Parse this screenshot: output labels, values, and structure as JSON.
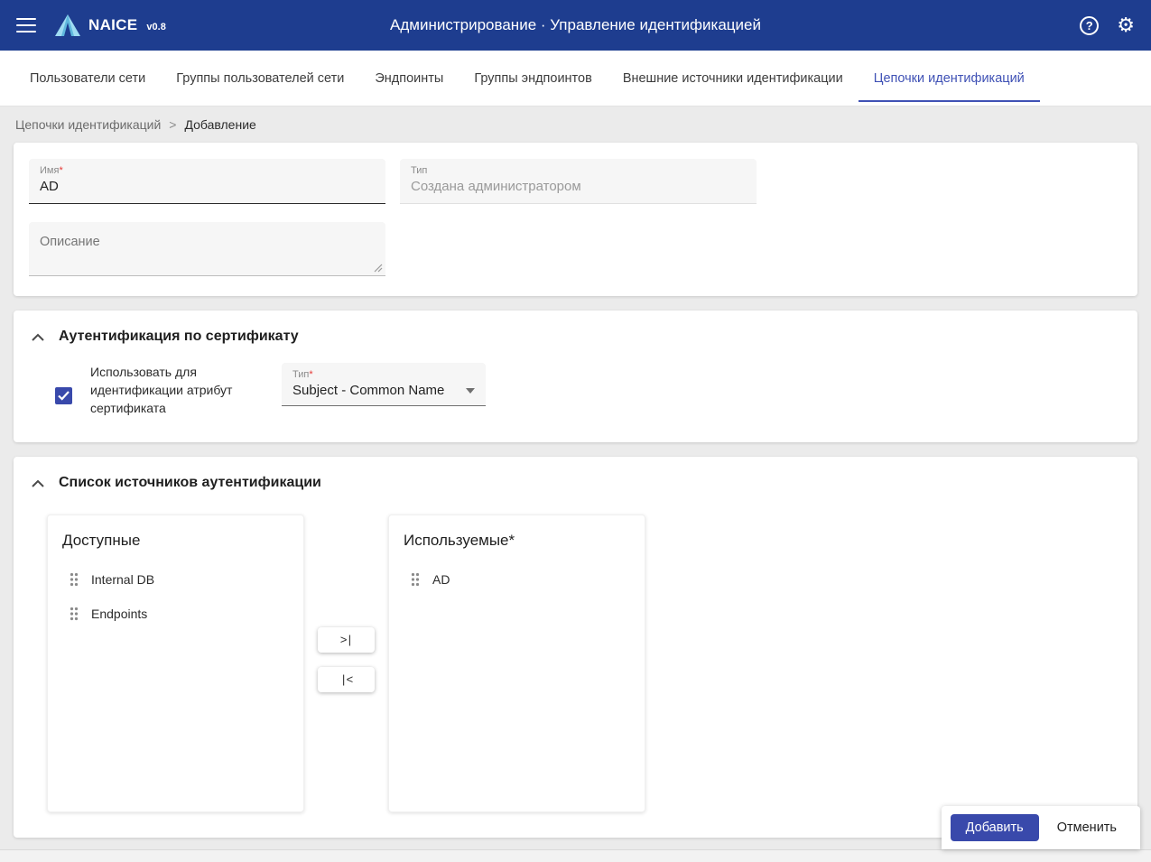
{
  "app_bar": {
    "brand": "NAICE",
    "version": "v0.8",
    "title": "Администрирование · Управление идентификацией"
  },
  "tabs": [
    {
      "label": "Пользователи сети",
      "active": false
    },
    {
      "label": "Группы пользователей сети",
      "active": false
    },
    {
      "label": "Эндпоинты",
      "active": false
    },
    {
      "label": "Группы эндпоинтов",
      "active": false
    },
    {
      "label": "Внешние источники идентификации",
      "active": false
    },
    {
      "label": "Цепочки идентификаций",
      "active": true
    }
  ],
  "breadcrumb": {
    "parent": "Цепочки идентификаций",
    "separator": ">",
    "current": "Добавление"
  },
  "form": {
    "name_field": {
      "label": "Имя",
      "required_mark": "*",
      "value": "AD"
    },
    "type_field": {
      "label": "Тип",
      "value": "Создана администратором"
    },
    "description_field": {
      "label": "Описание",
      "value": ""
    }
  },
  "cert_section": {
    "title": "Аутентификация по сертификату",
    "checkbox_label": "Использовать для идентификации атрибут сертификата",
    "checkbox_checked": true,
    "type_select": {
      "label": "Тип",
      "required_mark": "*",
      "value": "Subject - Common Name"
    }
  },
  "sources_section": {
    "title": "Список источников аутентификации",
    "available": {
      "title": "Доступные",
      "items": [
        "Internal DB",
        "Endpoints"
      ]
    },
    "used": {
      "title": "Используемые*",
      "items": [
        "AD"
      ]
    },
    "move_all_right_label": ">|",
    "move_all_left_label": "|<"
  },
  "footer": {
    "add_label": "Добавить",
    "cancel_label": "Отменить"
  },
  "colors": {
    "appbar": "#1e3d8f",
    "accent": "#3f51b5",
    "primary_button": "#3949ab",
    "required": "#e53935"
  },
  "help_icon_glyph": "?"
}
